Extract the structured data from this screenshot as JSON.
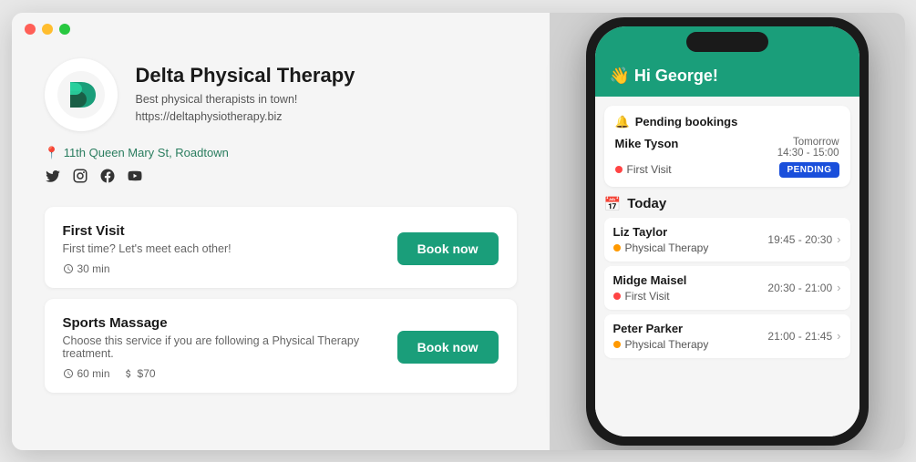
{
  "window": {
    "title": "Delta Physical Therapy"
  },
  "profile": {
    "name": "Delta Physical Therapy",
    "description": "Best physical therapists in town!",
    "website": "https://deltaphysiotherapy.biz",
    "address": "11th Queen Mary St, Roadtown",
    "social": {
      "twitter": "Twitter",
      "instagram": "Instagram",
      "facebook": "Facebook",
      "youtube": "YouTube"
    }
  },
  "services": [
    {
      "id": "first-visit",
      "title": "First Visit",
      "description": "First time? Let's meet each other!",
      "duration": "30 min",
      "price": null,
      "book_label": "Book now"
    },
    {
      "id": "sports-massage",
      "title": "Sports Massage",
      "description": "Choose this service if you are following a Physical Therapy treatment.",
      "duration": "60 min",
      "price": "$70",
      "book_label": "Book now"
    }
  ],
  "phone": {
    "greeting": "👋 Hi George!",
    "pending_bookings_title": "Pending bookings",
    "pending_bookings": [
      {
        "name": "Mike Tyson",
        "service": "First Visit",
        "service_dot": "red",
        "day": "Tomorrow",
        "time": "14:30 - 15:00",
        "status": "PENDING"
      }
    ],
    "today_title": "Today",
    "today_appointments": [
      {
        "name": "Liz Taylor",
        "service": "Physical Therapy",
        "service_dot": "orange",
        "time": "19:45 - 20:30"
      },
      {
        "name": "Midge Maisel",
        "service": "First Visit",
        "service_dot": "red",
        "time": "20:30 - 21:00"
      },
      {
        "name": "Peter Parker",
        "service": "Physical Therapy",
        "service_dot": "orange",
        "time": "21:00 - 21:45"
      }
    ]
  },
  "icons": {
    "location": "📍",
    "clock": "🕐",
    "money": "💵",
    "bell": "🔔",
    "calendar": "📅"
  }
}
